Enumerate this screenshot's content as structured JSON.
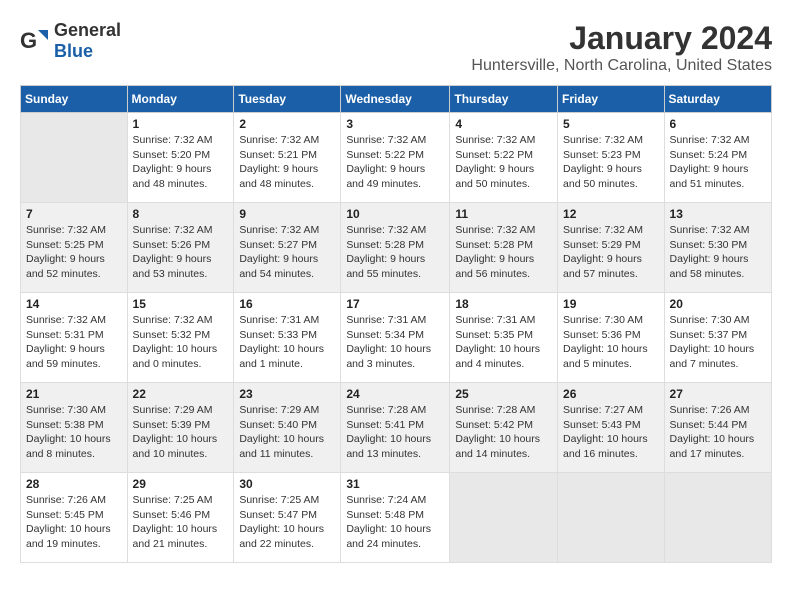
{
  "logo": {
    "general": "General",
    "blue": "Blue"
  },
  "title": "January 2024",
  "subtitle": "Huntersville, North Carolina, United States",
  "days_header": [
    "Sunday",
    "Monday",
    "Tuesday",
    "Wednesday",
    "Thursday",
    "Friday",
    "Saturday"
  ],
  "weeks": [
    [
      {
        "day": "",
        "info": ""
      },
      {
        "day": "1",
        "info": "Sunrise: 7:32 AM\nSunset: 5:20 PM\nDaylight: 9 hours\nand 48 minutes."
      },
      {
        "day": "2",
        "info": "Sunrise: 7:32 AM\nSunset: 5:21 PM\nDaylight: 9 hours\nand 48 minutes."
      },
      {
        "day": "3",
        "info": "Sunrise: 7:32 AM\nSunset: 5:22 PM\nDaylight: 9 hours\nand 49 minutes."
      },
      {
        "day": "4",
        "info": "Sunrise: 7:32 AM\nSunset: 5:22 PM\nDaylight: 9 hours\nand 50 minutes."
      },
      {
        "day": "5",
        "info": "Sunrise: 7:32 AM\nSunset: 5:23 PM\nDaylight: 9 hours\nand 50 minutes."
      },
      {
        "day": "6",
        "info": "Sunrise: 7:32 AM\nSunset: 5:24 PM\nDaylight: 9 hours\nand 51 minutes."
      }
    ],
    [
      {
        "day": "7",
        "info": "Sunrise: 7:32 AM\nSunset: 5:25 PM\nDaylight: 9 hours\nand 52 minutes."
      },
      {
        "day": "8",
        "info": "Sunrise: 7:32 AM\nSunset: 5:26 PM\nDaylight: 9 hours\nand 53 minutes."
      },
      {
        "day": "9",
        "info": "Sunrise: 7:32 AM\nSunset: 5:27 PM\nDaylight: 9 hours\nand 54 minutes."
      },
      {
        "day": "10",
        "info": "Sunrise: 7:32 AM\nSunset: 5:28 PM\nDaylight: 9 hours\nand 55 minutes."
      },
      {
        "day": "11",
        "info": "Sunrise: 7:32 AM\nSunset: 5:28 PM\nDaylight: 9 hours\nand 56 minutes."
      },
      {
        "day": "12",
        "info": "Sunrise: 7:32 AM\nSunset: 5:29 PM\nDaylight: 9 hours\nand 57 minutes."
      },
      {
        "day": "13",
        "info": "Sunrise: 7:32 AM\nSunset: 5:30 PM\nDaylight: 9 hours\nand 58 minutes."
      }
    ],
    [
      {
        "day": "14",
        "info": "Sunrise: 7:32 AM\nSunset: 5:31 PM\nDaylight: 9 hours\nand 59 minutes."
      },
      {
        "day": "15",
        "info": "Sunrise: 7:32 AM\nSunset: 5:32 PM\nDaylight: 10 hours\nand 0 minutes."
      },
      {
        "day": "16",
        "info": "Sunrise: 7:31 AM\nSunset: 5:33 PM\nDaylight: 10 hours\nand 1 minute."
      },
      {
        "day": "17",
        "info": "Sunrise: 7:31 AM\nSunset: 5:34 PM\nDaylight: 10 hours\nand 3 minutes."
      },
      {
        "day": "18",
        "info": "Sunrise: 7:31 AM\nSunset: 5:35 PM\nDaylight: 10 hours\nand 4 minutes."
      },
      {
        "day": "19",
        "info": "Sunrise: 7:30 AM\nSunset: 5:36 PM\nDaylight: 10 hours\nand 5 minutes."
      },
      {
        "day": "20",
        "info": "Sunrise: 7:30 AM\nSunset: 5:37 PM\nDaylight: 10 hours\nand 7 minutes."
      }
    ],
    [
      {
        "day": "21",
        "info": "Sunrise: 7:30 AM\nSunset: 5:38 PM\nDaylight: 10 hours\nand 8 minutes."
      },
      {
        "day": "22",
        "info": "Sunrise: 7:29 AM\nSunset: 5:39 PM\nDaylight: 10 hours\nand 10 minutes."
      },
      {
        "day": "23",
        "info": "Sunrise: 7:29 AM\nSunset: 5:40 PM\nDaylight: 10 hours\nand 11 minutes."
      },
      {
        "day": "24",
        "info": "Sunrise: 7:28 AM\nSunset: 5:41 PM\nDaylight: 10 hours\nand 13 minutes."
      },
      {
        "day": "25",
        "info": "Sunrise: 7:28 AM\nSunset: 5:42 PM\nDaylight: 10 hours\nand 14 minutes."
      },
      {
        "day": "26",
        "info": "Sunrise: 7:27 AM\nSunset: 5:43 PM\nDaylight: 10 hours\nand 16 minutes."
      },
      {
        "day": "27",
        "info": "Sunrise: 7:26 AM\nSunset: 5:44 PM\nDaylight: 10 hours\nand 17 minutes."
      }
    ],
    [
      {
        "day": "28",
        "info": "Sunrise: 7:26 AM\nSunset: 5:45 PM\nDaylight: 10 hours\nand 19 minutes."
      },
      {
        "day": "29",
        "info": "Sunrise: 7:25 AM\nSunset: 5:46 PM\nDaylight: 10 hours\nand 21 minutes."
      },
      {
        "day": "30",
        "info": "Sunrise: 7:25 AM\nSunset: 5:47 PM\nDaylight: 10 hours\nand 22 minutes."
      },
      {
        "day": "31",
        "info": "Sunrise: 7:24 AM\nSunset: 5:48 PM\nDaylight: 10 hours\nand 24 minutes."
      },
      {
        "day": "",
        "info": ""
      },
      {
        "day": "",
        "info": ""
      },
      {
        "day": "",
        "info": ""
      }
    ]
  ]
}
